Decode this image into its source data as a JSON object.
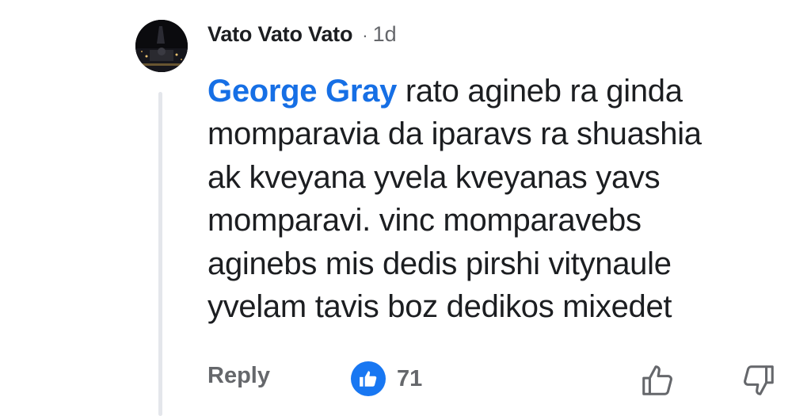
{
  "comment": {
    "author": "Vato Vato Vato",
    "separator": "·",
    "time": "1d",
    "mention": "George Gray",
    "text": " rato agineb ra ginda\nmomparavia da iparavs ra shuashia\nak kveyana  yvela kveyanas yavs\nmomparavi. vinc momparavebs\naginebs  mis dedis pirshi vitynaule\nyvelam tavis boz dedikos mixedet"
  },
  "actions": {
    "reply_label": "Reply",
    "reaction_count": "71",
    "reaction_icon": "like-icon",
    "upvote_icon": "thumbs-up-outline-icon",
    "downvote_icon": "thumbs-down-outline-icon"
  },
  "colors": {
    "mention": "#166fe5",
    "like_badge": "#1877f2",
    "secondary_text": "#65676b",
    "thread_line": "#e4e6eb"
  }
}
